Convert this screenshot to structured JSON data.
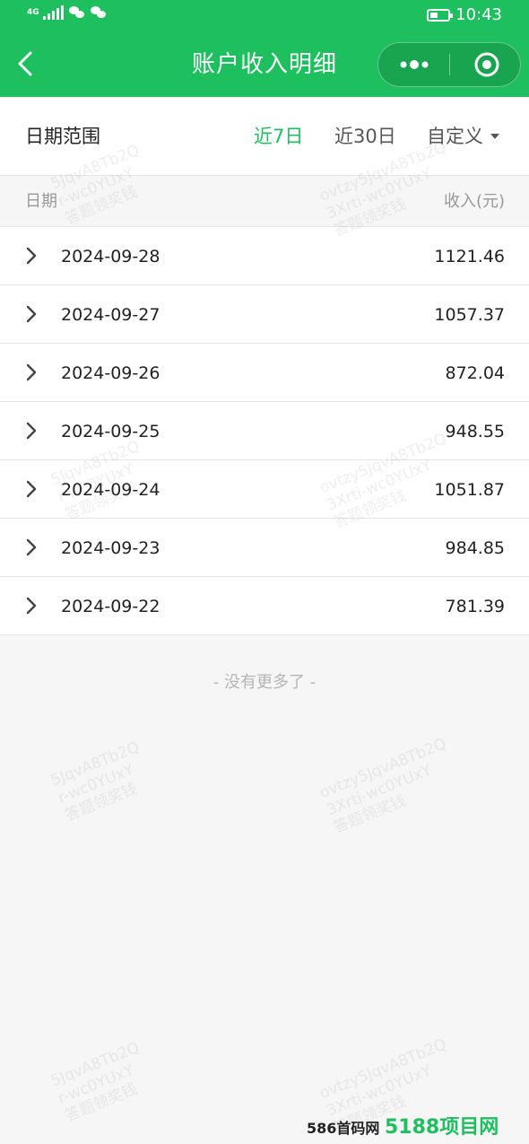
{
  "status_bar": {
    "network": "4G",
    "time": "10:43"
  },
  "nav": {
    "title": "账户收入明细"
  },
  "filter": {
    "label": "日期范围",
    "options": [
      "近7日",
      "近30日",
      "自定义"
    ],
    "selected": "近7日"
  },
  "table": {
    "headers": {
      "date": "日期",
      "income": "收入(元)"
    },
    "rows": [
      {
        "date": "2024-09-28",
        "income": "1121.46"
      },
      {
        "date": "2024-09-27",
        "income": "1057.37"
      },
      {
        "date": "2024-09-26",
        "income": "872.04"
      },
      {
        "date": "2024-09-25",
        "income": "948.55"
      },
      {
        "date": "2024-09-24",
        "income": "1051.87"
      },
      {
        "date": "2024-09-23",
        "income": "984.85"
      },
      {
        "date": "2024-09-22",
        "income": "781.39"
      }
    ]
  },
  "end_note": "- 没有更多了 -",
  "watermark": {
    "left": "5JqvA8Tb2Q\nr-wc0YUxY\n答题领奖钱",
    "right": "ovtzy5JqvA8Tb2Q\n3Xrti-wc0YUxY\n答题领奖钱"
  },
  "footer_mark": {
    "text": "586首码网",
    "badge": "5188项目网"
  },
  "colors": {
    "brand_green": "#1ebf5e",
    "background": "#f6f6f6",
    "divider": "#e6e6e6"
  },
  "icons": {
    "back": "chevron-left-icon",
    "more": "more-dots-icon",
    "close": "target-circle-icon",
    "row": "chevron-right-icon",
    "dropdown": "caret-down-icon"
  }
}
